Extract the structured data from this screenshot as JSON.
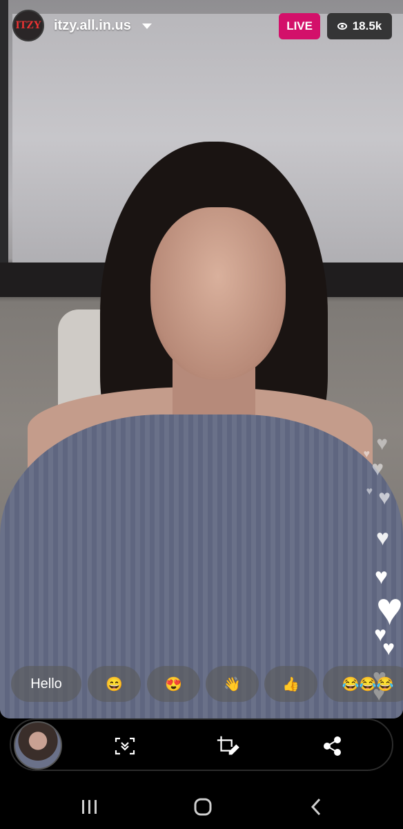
{
  "header": {
    "profile_logo_text": "ITZY",
    "username": "itzy.all.in.us",
    "live_label": "LIVE",
    "viewer_count": "18.5k"
  },
  "quick_replies": [
    {
      "label": "Hello"
    },
    {
      "label": "😄"
    },
    {
      "label": "😍"
    },
    {
      "label": "👋"
    },
    {
      "label": "👍"
    },
    {
      "label": "😂😂😂"
    }
  ],
  "bottom_bar": {
    "icons": [
      "expand-icon",
      "crop-edit-icon",
      "share-icon"
    ]
  },
  "navbar": {
    "icons": [
      "recent-apps-icon",
      "home-icon",
      "back-icon"
    ]
  },
  "colors": {
    "live_badge": "#d3106a",
    "chip_bg": "rgba(90,90,90,0.62)"
  }
}
